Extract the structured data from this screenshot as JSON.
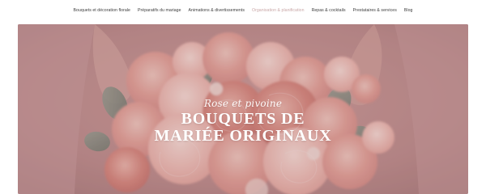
{
  "nav": {
    "items": [
      {
        "label": "Bouquets et décoration florale",
        "active": false
      },
      {
        "label": "Préparatifs du mariage",
        "active": false
      },
      {
        "label": "Animations & divertissements",
        "active": false
      },
      {
        "label": "Organisation & planification",
        "active": true
      },
      {
        "label": "Repas & cocktails",
        "active": false
      },
      {
        "label": "Prestataires & services",
        "active": false
      },
      {
        "label": "Blog",
        "active": false
      }
    ]
  },
  "hero": {
    "kicker": "Rose et pivoine",
    "title_line1": "BOUQUETS DE",
    "title_line2": "MARIÉE ORIGINAUX",
    "image_semantic": "bridal-bouquet-photo"
  },
  "colors": {
    "nav_text": "#3b3b3b",
    "nav_active": "#c9a7a7",
    "hero_overlay": "#b97878",
    "hero_text": "#ffffff"
  }
}
